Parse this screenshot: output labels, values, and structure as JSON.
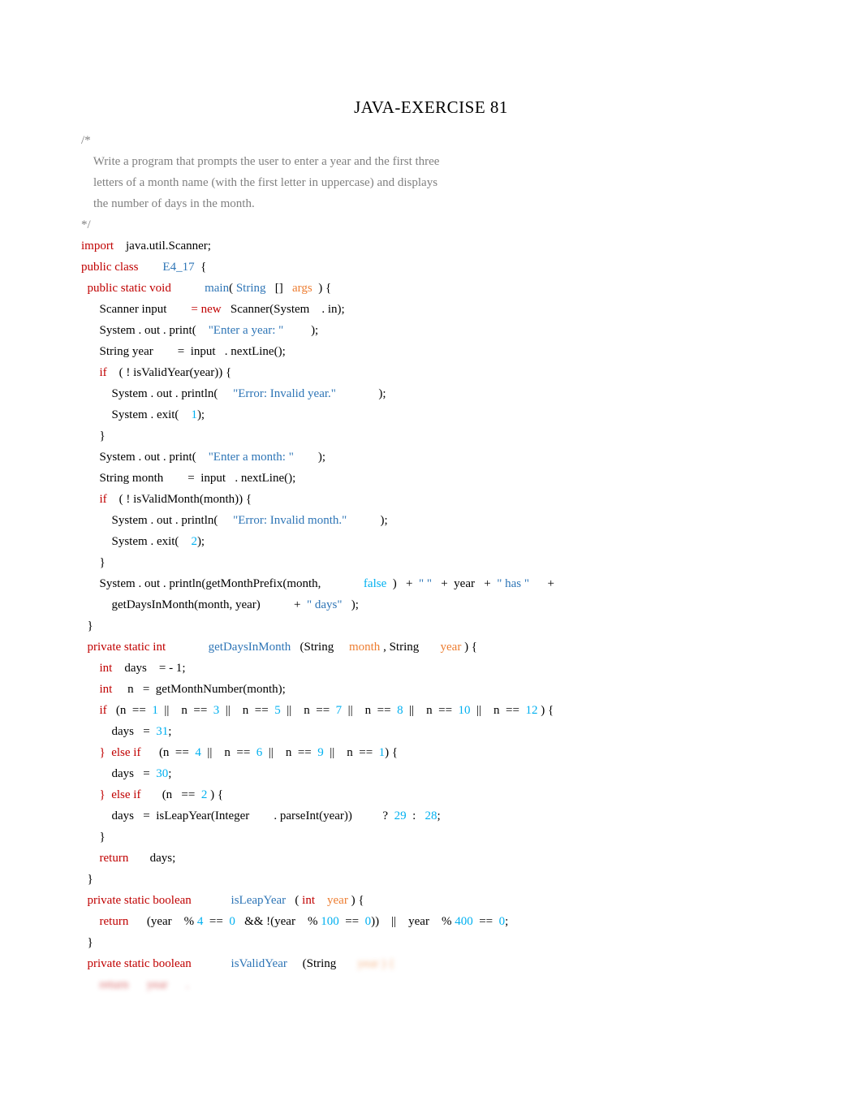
{
  "title": "JAVA-EXERCISE 81",
  "code": {
    "c0": "/*",
    "c1": "    Write a program that prompts the user to enter a year and the first three",
    "c2": "    letters of a month name (with the first letter in uppercase) and displays",
    "c3": "    the number of days in the month.",
    "c4": "*/",
    "imp": "import",
    "imp2": "    java.util.Scanner;",
    "pubclass": "public class",
    "clsname": "        E4_17",
    "brace": "  {",
    "psv": "  public static void",
    "main": "           main",
    "mainarg_p1": "( ",
    "strType": "String",
    "brackets": "   []   ",
    "args": "args",
    "closeArgs": "  ) {",
    "scannerLine": "      Scanner input        ",
    "eqnew": "= new",
    "scannerCtor": "   Scanner(System    ",
    "dotIn": ". in);",
    "sysout1a": "      System ",
    "dot1": ". ",
    "out1": "out ",
    "print1": ". print(    ",
    "prompt1": "\"Enter a year: \"",
    "endp1": "         );",
    "stringYear": "      String year        ",
    "eqInput": "=  input   ",
    "nextLine": ". nextLine();",
    "if1": "      if",
    "notValidYear": "    ( ! isValidYear(year)) {",
    "sysout2a": "          System ",
    "println1": ". println(     ",
    "errYear": "\"Error: Invalid year.\"",
    "endp2": "              );",
    "exit1": "          System ",
    "dotExit1": ". exit(    ",
    "one": "1",
    "closeExit1": ");",
    "closeBrace1": "      }",
    "sysout3a": "      System ",
    "print2": ". print(    ",
    "prompt2": "\"Enter a month: \"",
    "endp3": "        );",
    "stringMonth": "      String month        ",
    "eqInput2": "=  input   ",
    "if2": "      if",
    "notValidMonth": "    ( ! isValidMonth(month)) {",
    "sysout4a": "          System ",
    "errMonth": "\"Error: Invalid month.\"",
    "endp4": "           );",
    "exit2": "          System ",
    "two": "2",
    "closeExit2": ");",
    "closeBrace2": "      }",
    "sysout5a": "      System ",
    "println2": ". println(getMonthPrefix(month,              ",
    "falseLit": "false",
    "concat1": "  )   +  ",
    "space": "\" \"",
    "concat2": "   +  year   + ",
    "has": " \" has \"",
    "plus": "      +",
    "getDays": "          getDaysInMonth(month, year)           + ",
    "daysStr": " \" days\"",
    "endp5": "   );",
    "closeMain": "  }",
    "psi": "  private static int",
    "getDaysMethod": "              getDaysInMonth",
    "getDaysParams1": "   (String     ",
    "monthParam": "month",
    "getDaysParams2": " , String       ",
    "yearParam": "year",
    "getDaysParams3": " ) {",
    "intDays": "      int",
    "daysInit": "    days    = ",
    "neg1": "- 1",
    "semi": ";",
    "intN": "      int",
    "nInit": "     n   =  getMonthNumber(month);",
    "ifN": "      if",
    "ncond": "   (n  ==  ",
    "n1": "1",
    "or": "  ||    ",
    "neq": "n  ==  ",
    "n3": "3",
    "n5": "5",
    "n7": "7",
    "n8": "8",
    "n10": "10",
    "n12": "12",
    "closeIf": " ) {",
    "days31a": "          days   =  ",
    "d31": "31",
    "elseif1": "      }  else if",
    "ncond2": "      (n  ==  ",
    "n4": "4",
    "n6": "6",
    "n9": "9",
    "closeIf2": ") {",
    "days30a": "          days   =  ",
    "d30": "30",
    "elseif2": "      }  else if",
    "ncond3": "       (n   ==  ",
    "n2": "2",
    "closeIf3": " ) {",
    "daysLeap": "          days   =  isLeapYear(Integer        ",
    "parseInt": ". parseInt(year))          ",
    "tern": "?  ",
    "d29": "29",
    "colon": "  :   ",
    "d28": "28",
    "closeBrace3": "      }",
    "ret": "      return",
    "retDays": "       days;",
    "closeMethod1": "  }",
    "psb": "  private static boolean",
    "isLeap": "             isLeapYear",
    "leapParams": "   ( ",
    "intType": "int",
    "yearParam2": "    year",
    "closeLeapParams": " ) {",
    "retLeap": "      return",
    "leapExpr1": "      (year    ",
    "pct": "% ",
    "four": "4",
    "eqeq": "  ==  ",
    "zero": "0",
    "andand": "   && !",
    "leapExpr2": "(year    ",
    "hundred": "100",
    "zero2": "0",
    "closeP": "))    ||    year    ",
    "fourHundred": "400",
    "zero3": "0",
    "closeMethod2": "  }",
    "psb2": "  private static boolean",
    "isValidY": "             isValidYear",
    "validYParams": "     (String       ",
    "yearBlur": "year ) {",
    "retBlur": "      return      year      .",
    "dot": "."
  }
}
